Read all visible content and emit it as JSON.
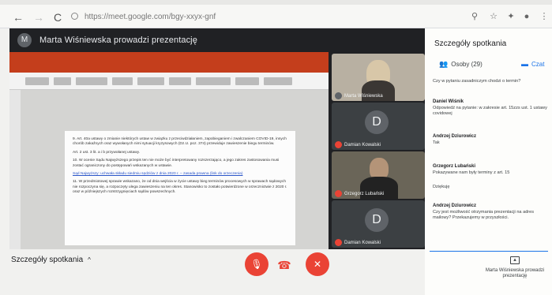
{
  "browser": {
    "back": "←",
    "forward": "→",
    "reload": "C",
    "url": "https://meet.google.com/bgy-xxyx-gnf"
  },
  "meeting": {
    "avatar_letter": "M",
    "presenting_text": "Marta Wiśniewska prowadzi prezentację",
    "slide_paragraphs": [
      "9. Art. 40a ustawy o zmianie niektórych ustaw w związku z przeciwdziałaniem, zapobieganiem i zwalczaniem COVID-19, innych chorób zakaźnych oraz wywołanych nimi sytuacji kryzysowych (Dz.U. poz. 374) przewiduje zawieszenie biegu terminów.",
      "Art. 2 ust. 3 lit. a i b przywołanej ustawy.",
      "10. W ocenie Sądu Najwyższego przepis ten nie może być interpretowany rozszerzająco, a jego zakres zastosowania musi zostać ograniczony do postępowań wskazanych w ustawie.",
      "Sąd Najwyższy: uchwała składu siedmiu sędziów z dnia 2020 r. – zasada prawna (link do orzeczenia)",
      "11. W przedmiotowej sprawie wskazano, że od dnia wejścia w życie ustawy bieg terminów procesowych w sprawach sądowych nie rozpoczyna się, a rozpoczęty ulega zawieszeniu na ten okres. Stanowisko to zostało potwierdzone w orzecznictwie z 2020 r. oraz w późniejszych rozstrzygnięciach sądów powszechnych."
    ],
    "participants": [
      {
        "name": "Marta Wiśniewska",
        "initial": ""
      },
      {
        "name": "Damian Kowalski",
        "initial": "D"
      },
      {
        "name": "Grzegorz Lubański",
        "initial": ""
      },
      {
        "name": "Damian Kowalski",
        "initial": "D"
      }
    ]
  },
  "panel": {
    "title": "Szczegóły spotkania",
    "people_tab": "Osoby (29)",
    "chat_tab": "Czat",
    "messages": [
      {
        "sender": "",
        "text": "Czy w pytaniu zasadniczym chodzi o termin?"
      },
      {
        "sender": "Daniel Wiśnik",
        "text": "Odpowiedź na pytanie: w zakresie art. 15zzs ust. 1 ustawy covidowej"
      },
      {
        "sender": "Andrzej Dziurowicz",
        "text": "Tak"
      },
      {
        "sender": "Grzegorz Lubański",
        "text": "Pokazywane nam były terminy z art. 15"
      },
      {
        "sender": "",
        "text": "Dziękuję"
      },
      {
        "sender": "Andrzej Dziurowicz",
        "text": "Czy jest możliwość otrzymania prezentacji na adres mailowy? Przekazujemy w przyszłości."
      }
    ]
  },
  "bottom": {
    "details_label": "Szczegóły spotkania",
    "present_label": "Marta Wiśniewska prowadzi prezentację"
  },
  "colors": {
    "end_call": "#ea4335",
    "accent": "#1a73e8",
    "ppt_ribbon": "#c43e1c"
  }
}
